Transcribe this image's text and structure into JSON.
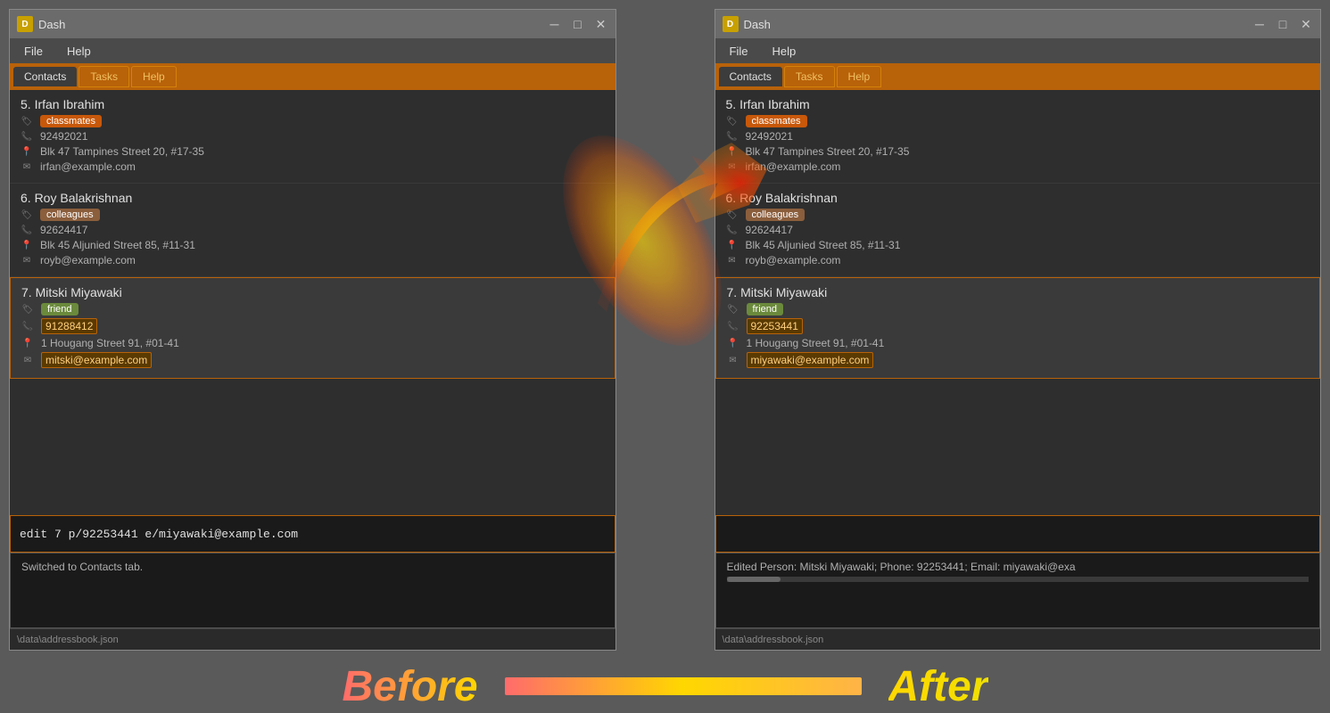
{
  "left_window": {
    "title": "Dash",
    "menu": [
      "File",
      "Help"
    ],
    "tabs": [
      "Contacts",
      "Tasks",
      "Help"
    ],
    "active_tab": "Contacts",
    "contacts": [
      {
        "number": "5.",
        "name": "Irfan Ibrahim",
        "tag": "classmates",
        "tag_class": "tag-classmates",
        "phone": "92492021",
        "address": "Blk 47 Tampines Street 20, #17-35",
        "email": "irfan@example.com"
      },
      {
        "number": "6.",
        "name": "Roy Balakrishnan",
        "tag": "colleagues",
        "tag_class": "tag-colleagues",
        "phone": "92624417",
        "address": "Blk 45 Aljunied Street 85, #11-31",
        "email": "royb@example.com"
      },
      {
        "number": "7.",
        "name": "Mitski Miyawaki",
        "tag": "friend",
        "tag_class": "tag-friend",
        "phone": "91288412",
        "phone_highlighted": true,
        "address": "1 Hougang Street 91, #01-41",
        "email": "mitski@example.com",
        "email_highlighted": true
      }
    ],
    "command": "edit 7 p/92253441 e/miyawaki@example.com",
    "output": "Switched to Contacts tab.",
    "status": "\\data\\addressbook.json"
  },
  "right_window": {
    "title": "Dash",
    "menu": [
      "File",
      "Help"
    ],
    "tabs": [
      "Contacts",
      "Tasks",
      "Help"
    ],
    "active_tab": "Contacts",
    "contacts": [
      {
        "number": "5.",
        "name": "Irfan Ibrahim",
        "tag": "classmates",
        "tag_class": "tag-classmates",
        "phone": "92492021",
        "address": "Blk 47 Tampines Street 20, #17-35",
        "email": "irfan@example.com"
      },
      {
        "number": "6.",
        "name": "Roy Balakrishnan",
        "tag": "colleagues",
        "tag_class": "tag-colleagues",
        "phone": "92624417",
        "address": "Blk 45 Aljunied Street 85, #11-31",
        "email": "royb@example.com"
      },
      {
        "number": "7.",
        "name": "Mitski Miyawaki",
        "tag": "friend",
        "tag_class": "tag-friend",
        "phone": "92253441",
        "phone_highlighted": true,
        "address": "1 Hougang Street 91, #01-41",
        "email": "miyawaki@example.com",
        "email_highlighted": true
      }
    ],
    "command": "",
    "output": "Edited Person: Mitski Miyawaki; Phone: 92253441; Email: miyawaki@exa",
    "status": "\\data\\addressbook.json"
  },
  "labels": {
    "before": "Before",
    "after": "After"
  }
}
